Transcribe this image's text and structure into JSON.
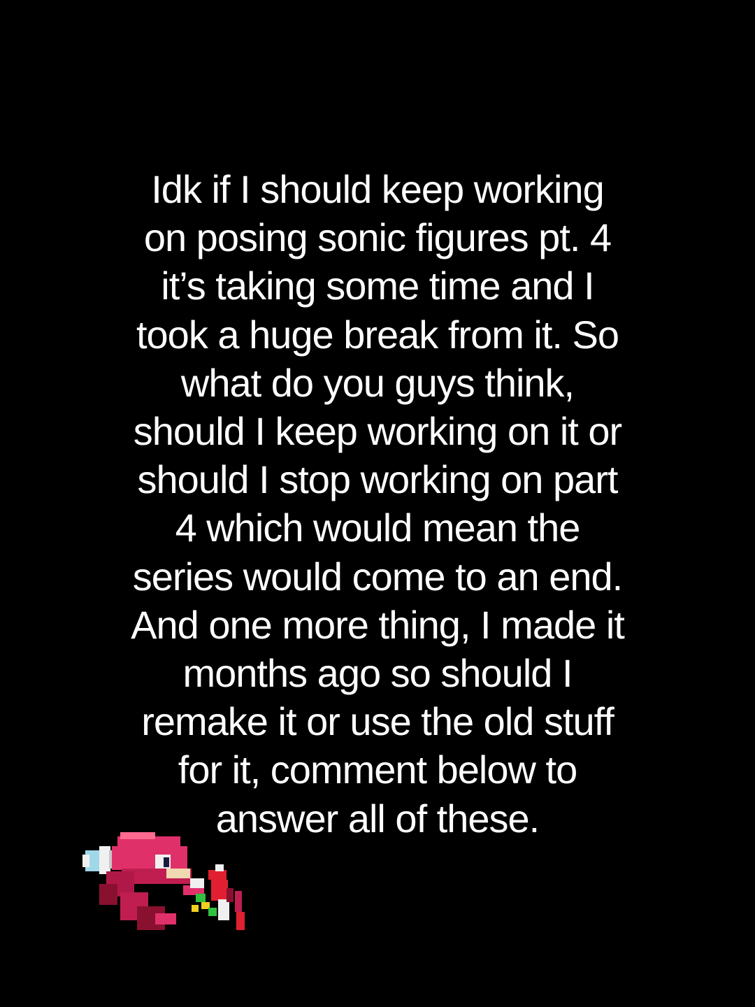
{
  "background_color": "#000000",
  "text_color": "#ffffff",
  "caption": {
    "lines": [
      "Idk if I should keep working",
      "on posing sonic figures pt. 4",
      "it’s taking some time and I",
      "took a huge break from it. So",
      "what do you guys think,",
      "should I keep working on it or",
      "should I stop working on part",
      "4 which would mean the",
      "series would come to an end.",
      "And one more thing, I made it",
      "months ago so should I",
      "remake it or use the old stuff",
      "for it, comment below to",
      "answer all of these."
    ]
  },
  "sprite": {
    "icon": "knuckles-sprite-icon",
    "colors": {
      "red": "#e0306a",
      "dark_red": "#8a1030",
      "white": "#f0f0f0",
      "cyan": "#9fd8e8",
      "green": "#30c040",
      "yellow": "#f0d020"
    }
  }
}
